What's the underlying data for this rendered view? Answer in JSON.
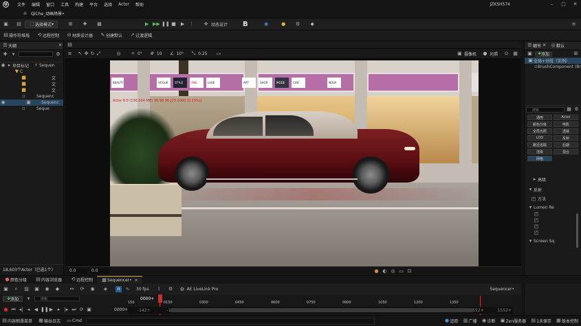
{
  "menu": {
    "items": [
      "文件",
      "编辑",
      "窗口",
      "工具",
      "构建",
      "平台",
      "选择",
      "Actor",
      "帮助"
    ],
    "project": "JZKSH574"
  },
  "tab": {
    "title": "QiChe_动画场景•"
  },
  "toolbar": {
    "mode": "选择模式",
    "anim_design": "动态设计",
    "save_icon": "save-icon"
  },
  "toolbar2": {
    "items": [
      "操作符堆栈",
      "远程控制",
      "材质设计器",
      "创建默认",
      "过渡逻辑"
    ]
  },
  "outliner": {
    "title": "大纲",
    "rows": [
      {
        "label": "项目标记",
        "type": "Sequen"
      },
      {
        "label": "C",
        "type": ""
      },
      {
        "label": "",
        "type": "文"
      },
      {
        "label": "",
        "type": "文"
      },
      {
        "label": "",
        "type": "文"
      },
      {
        "label": "",
        "type": "Sequenc"
      },
      {
        "label": "",
        "type": "Sequenc"
      },
      {
        "label": "",
        "type": "Seque"
      }
    ],
    "count": "18,603个Actor（已选1个）",
    "coord_a": "0.0",
    "coord_b": "0.0"
  },
  "viewport": {
    "tools": {
      "fov_a": "0°",
      "snap_a": "10",
      "snap_b": "10°",
      "scale": "0.25"
    },
    "camera": "摄像机",
    "lighting": "光照",
    "overlay_text": "Actor 8.0 (136,564 MB) 36.98 96 [23.1000 (0.13%)]",
    "storefronts": [
      "BEAUTY",
      "VOGUE",
      "STYLE",
      "ONE",
      "LUXE",
      "ART",
      "SHOP",
      "MODE",
      "CHIC",
      "NOVA"
    ]
  },
  "details": {
    "title": "细节",
    "tab2": "默认",
    "add": "添加",
    "component_root": "全局+分段（实例）",
    "component_child": "BrushComponent (Br",
    "search_placeholder": "搜索",
    "category_buttons": [
      "通用",
      "Actor",
      "颜色分级",
      "电影",
      "全局光照",
      "透镜",
      "LOD",
      "反射",
      "路径追踪",
      "后期",
      "渲染",
      "混合",
      "网格"
    ],
    "labels": [
      "高级",
      "反射",
      "方法",
      "Lumen Re",
      "Screen Sq"
    ]
  },
  "seqtabs": {
    "items": [
      "颜色分级",
      "内容浏览器",
      "远程控制",
      "Sequencer•"
    ],
    "close": "×"
  },
  "seqtool": {
    "fps": "30 fps",
    "plugin": "AE LiveLink Pro",
    "seq_name": "Sequencer•",
    "add": "添加",
    "search_placeholder": "搜索",
    "playhead": "0000+"
  },
  "timeline": {
    "ticks": [
      "150",
      "0150",
      "0300",
      "0450",
      "0600",
      "0750",
      "0900",
      "1050",
      "1200",
      "1350"
    ],
    "start": "0000+",
    "in": "-142+",
    "in2": "-142+",
    "out": "1552+",
    "end": "1552+"
  },
  "status": {
    "items": [
      "内容侧滑菜单",
      "输出日志",
      "Cmd"
    ],
    "right": [
      "追踪",
      "广播",
      "诊断",
      "Zen服务器",
      "1未保存",
      "版本控制"
    ]
  }
}
